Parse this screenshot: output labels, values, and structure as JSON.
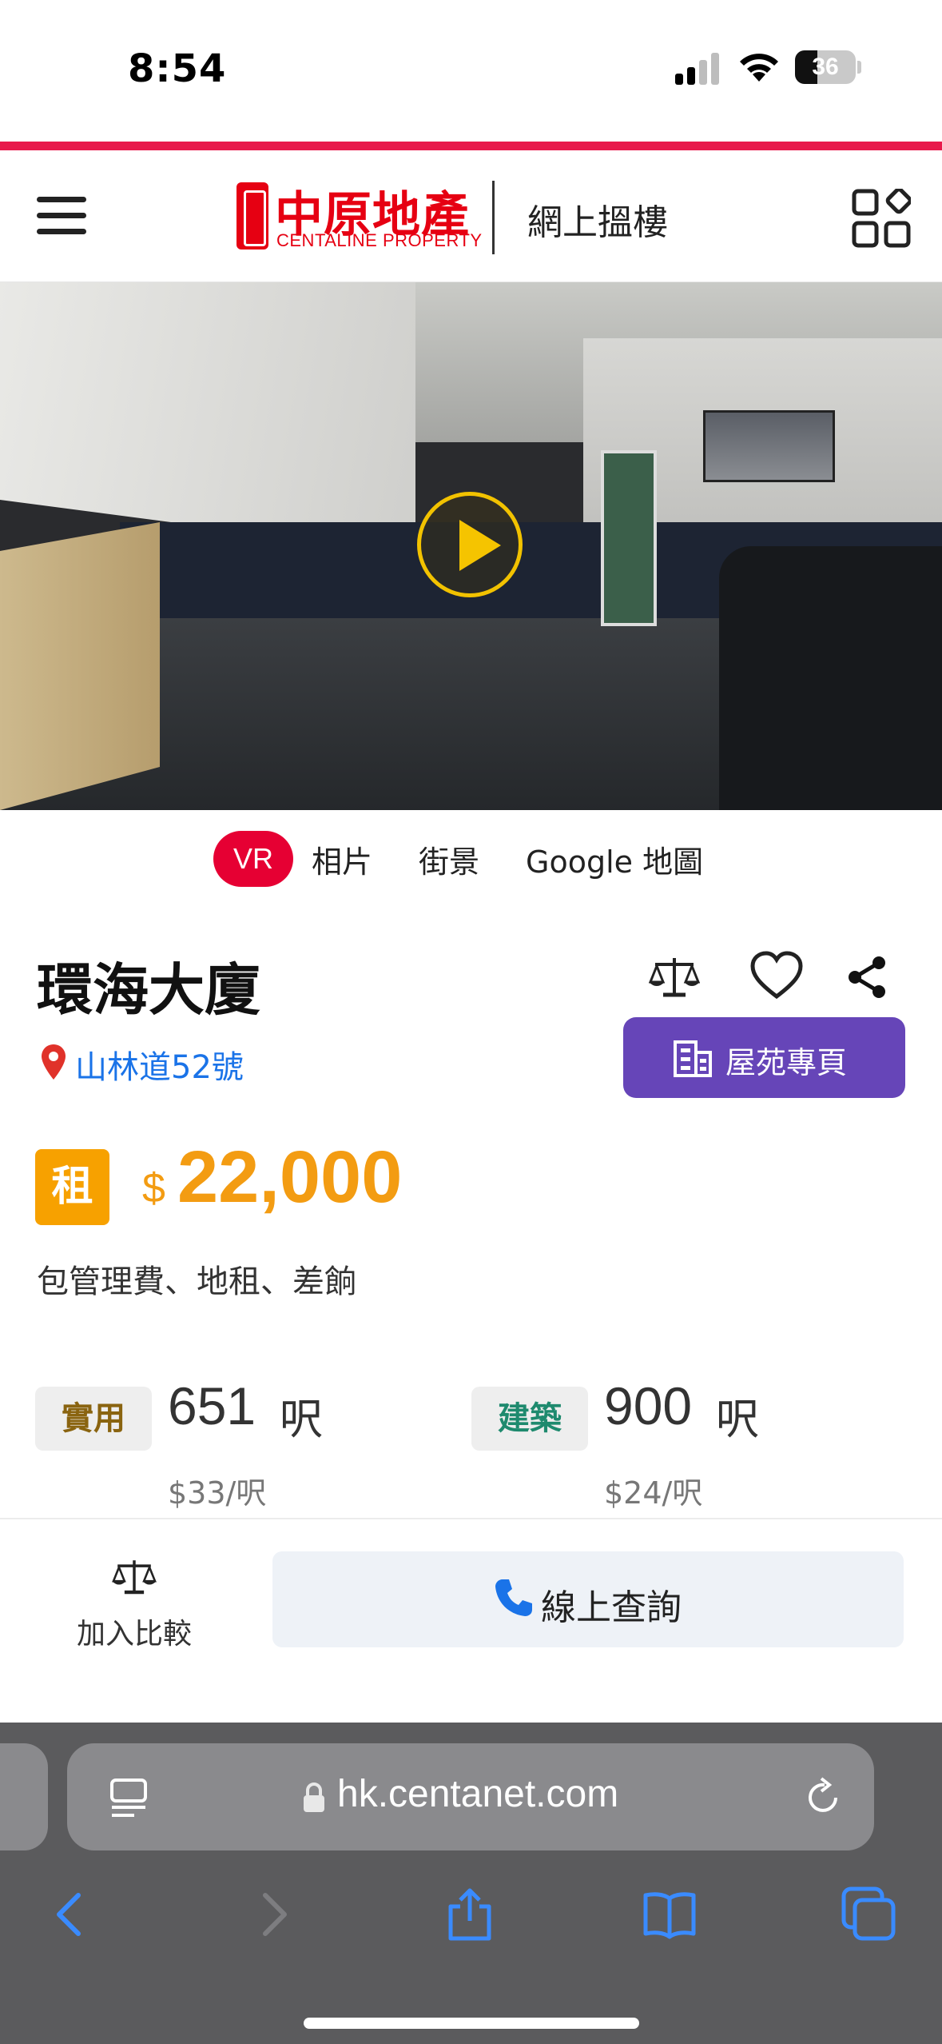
{
  "status_bar": {
    "time": "8:54",
    "battery": "36"
  },
  "colors": {
    "accent": "#e8194b",
    "brand_red": "#e60012",
    "price_orange": "#f39c12",
    "estate_button": "#6645b8",
    "link_blue": "#1a73e8"
  },
  "header": {
    "logo_cn": "中原地產",
    "logo_en": "CENTALINE PROPERTY",
    "title": "網上搵樓",
    "menu_icon": "hamburger-icon",
    "apps_icon": "grid-apps-icon"
  },
  "media_tabs": {
    "vr": "VR",
    "photos": "相片",
    "street_view": "街景",
    "map": "Google 地圖"
  },
  "property": {
    "name": "環海大廈",
    "address": "山林道52號",
    "estate_button": "屋苑專頁",
    "rent_badge": "租",
    "currency": "$",
    "price": "22,000",
    "includes": "包管理費、地租、差餉",
    "saleable": {
      "tag": "實用",
      "area": "651",
      "unit": "呎",
      "per_sqft": "$33/呎"
    },
    "gross": {
      "tag": "建築",
      "area": "900",
      "unit": "呎",
      "per_sqft": "$24/呎"
    }
  },
  "action_bar": {
    "add_compare": "加入比較",
    "enquiry": "線上查詢"
  },
  "browser": {
    "url": "hk.centanet.com"
  }
}
